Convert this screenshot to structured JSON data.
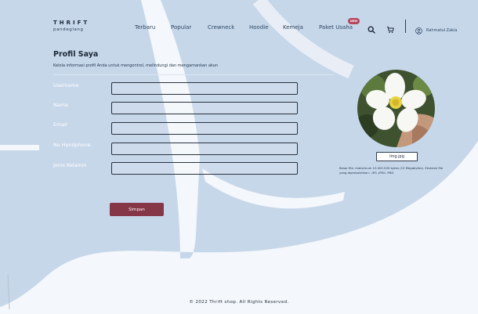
{
  "brand": {
    "name": "THRIFT",
    "sub": "pandeglang"
  },
  "nav": {
    "items": [
      "Terbaru",
      "Popular",
      "Crewneck",
      "Hoodie",
      "Kemeja",
      "Paket Usaha"
    ],
    "new_badge": "NEW"
  },
  "header_icons": {
    "search": "search-icon",
    "cart": "cart-icon",
    "user": "user-icon"
  },
  "user": {
    "name": "Rahmatul Zakia"
  },
  "page": {
    "title": "Profil Saya",
    "subtitle": "Kelola informasi profil Anda untuk mengontrol, melindungi dan mengamankan akun"
  },
  "form": {
    "fields": [
      {
        "label": "Username",
        "value": ""
      },
      {
        "label": "Nama",
        "value": ""
      },
      {
        "label": "Email",
        "value": ""
      },
      {
        "label": "No Handphone",
        "value": ""
      },
      {
        "label": "Jenis Kelamin",
        "value": ""
      }
    ],
    "save_label": "Simpan"
  },
  "photo": {
    "button_label": "Img.jpg",
    "note": "Besar file: maksimum 10.000.000 bytes (10 Megabytes). Ekstensi file yang diperbolehkan: .JPG .JPEG .PNG"
  },
  "footer": {
    "text": "© 2022 Thrift shop. All Rights Reserved."
  },
  "colors": {
    "background_shape": "#c6d7ea",
    "primary_button": "#853647",
    "badge": "#b5475f",
    "text": "#1e2a3a"
  }
}
